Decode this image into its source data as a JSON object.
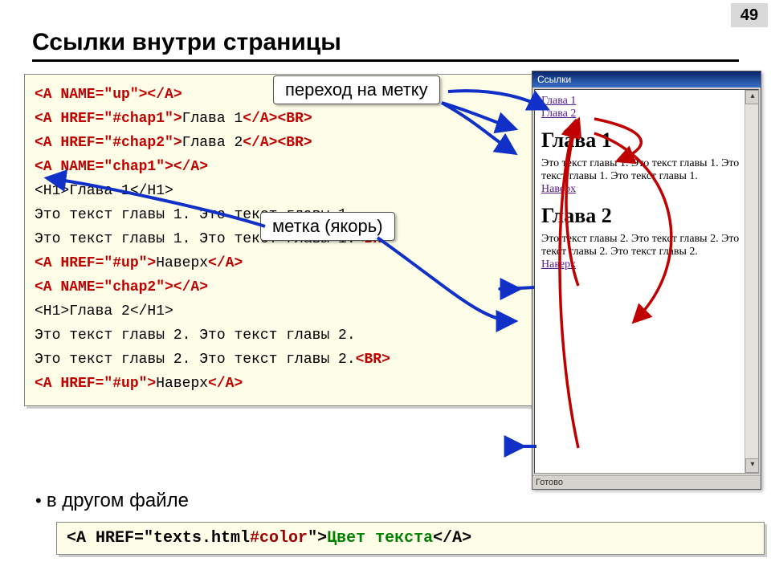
{
  "page_number": "49",
  "title": "Ссылки внутри страницы",
  "callout_top": "переход на метку",
  "callout_mid": "метка (якорь)",
  "code": {
    "l1a": "<A NAME=\"up\"></A>",
    "l2a": "<A HREF=\"#chap1\">",
    "l2b": "Глава 1",
    "l2c": "</A><BR>",
    "l3a": "<A HREF=\"#chap2\">",
    "l3b": "Глава 2",
    "l3c": "</A><BR>",
    "l4a": "<A NAME=\"chap1\"></A>",
    "l5": "<H1>Глава 1</H1>",
    "l6": "Это текст главы 1. Это текст главы 1.",
    "l7a": "Это текст главы 1. Это текст главы 1.",
    "l7b": "<BR>",
    "l8a": "<A HREF=\"#up\">",
    "l8b": "Наверх",
    "l8c": "</A>",
    "l9a": "<A NAME=\"chap2\"></A>",
    "l10": "<H1>Глава 2</H1>",
    "l11": "Это текст главы 2. Это текст главы 2.",
    "l12a": "Это текст главы 2. Это текст главы 2.",
    "l12b": "<BR>",
    "l13a": "<A HREF=\"#up\">",
    "l13b": "Наверх",
    "l13c": "</A>"
  },
  "bullet": "в другом файле",
  "code2": {
    "a": "<A HREF=\"texts.html",
    "frag": "#color",
    "b": "\">",
    "txt": "Цвет текста",
    "c": "</A>"
  },
  "browser": {
    "title": "Ссылки",
    "link1": "Глава 1",
    "link2": "Глава 2",
    "h1a": "Глава 1",
    "body1": "Это текст главы 1. Это текст главы 1. Это текст главы 1. Это текст главы 1.",
    "up": "Наверх",
    "h1b": "Глава 2",
    "body2": "Это текст главы 2. Это текст главы 2. Это текст главы 2. Это текст главы 2.",
    "status": "Готово"
  }
}
